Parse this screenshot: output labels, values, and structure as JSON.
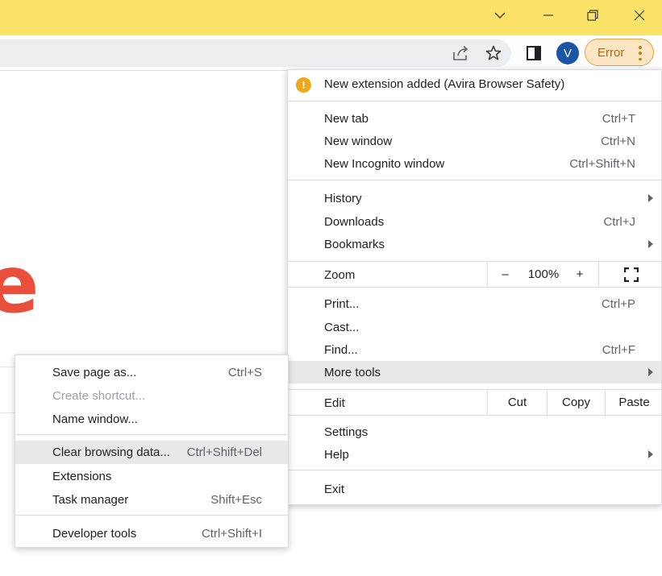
{
  "titlebar": {
    "bg_color": "#fbe36a",
    "buttons": [
      "chevron-down-icon",
      "minimize-icon",
      "restore-icon",
      "close-icon"
    ]
  },
  "toolbar": {
    "icons": [
      "share-icon",
      "bookmark-star-icon",
      "side-panel-icon"
    ],
    "avatar_letter": "V",
    "error_label": "Error",
    "error_color": "#e8a23a"
  },
  "page": {
    "fragment": "e",
    "fragment_color": "#e94f3a"
  },
  "main_menu": {
    "notification": "New extension added (Avira Browser Safety)",
    "new_tab": {
      "label": "New tab",
      "shortcut": "Ctrl+T"
    },
    "new_window": {
      "label": "New window",
      "shortcut": "Ctrl+N"
    },
    "new_incognito": {
      "label": "New Incognito window",
      "shortcut": "Ctrl+Shift+N"
    },
    "history": {
      "label": "History"
    },
    "downloads": {
      "label": "Downloads",
      "shortcut": "Ctrl+J"
    },
    "bookmarks": {
      "label": "Bookmarks"
    },
    "zoom": {
      "label": "Zoom",
      "minus": "–",
      "value": "100%",
      "plus": "+"
    },
    "print": {
      "label": "Print...",
      "shortcut": "Ctrl+P"
    },
    "cast": {
      "label": "Cast..."
    },
    "find": {
      "label": "Find...",
      "shortcut": "Ctrl+F"
    },
    "more_tools": {
      "label": "More tools"
    },
    "edit": {
      "label": "Edit",
      "cut": "Cut",
      "copy": "Copy",
      "paste": "Paste"
    },
    "settings": {
      "label": "Settings"
    },
    "help": {
      "label": "Help"
    },
    "exit": {
      "label": "Exit"
    }
  },
  "more_tools_menu": {
    "save_page": {
      "label": "Save page as...",
      "shortcut": "Ctrl+S"
    },
    "create_shortcut": {
      "label": "Create shortcut..."
    },
    "name_window": {
      "label": "Name window..."
    },
    "clear_data": {
      "label": "Clear browsing data...",
      "shortcut": "Ctrl+Shift+Del"
    },
    "extensions": {
      "label": "Extensions"
    },
    "task_manager": {
      "label": "Task manager",
      "shortcut": "Shift+Esc"
    },
    "dev_tools": {
      "label": "Developer tools",
      "shortcut": "Ctrl+Shift+I"
    }
  }
}
